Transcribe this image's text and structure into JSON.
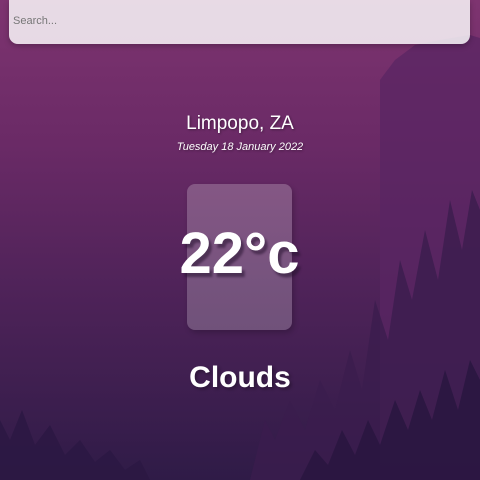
{
  "search": {
    "placeholder": "Search...",
    "value": ""
  },
  "weather": {
    "location": "Limpopo, ZA",
    "date": "Tuesday 18 January 2022",
    "temperature": "22°c",
    "condition": "Clouds"
  },
  "colors": {
    "background_top": "#7e3470",
    "background_bottom": "#2f1b47",
    "text": "#ffffff"
  }
}
